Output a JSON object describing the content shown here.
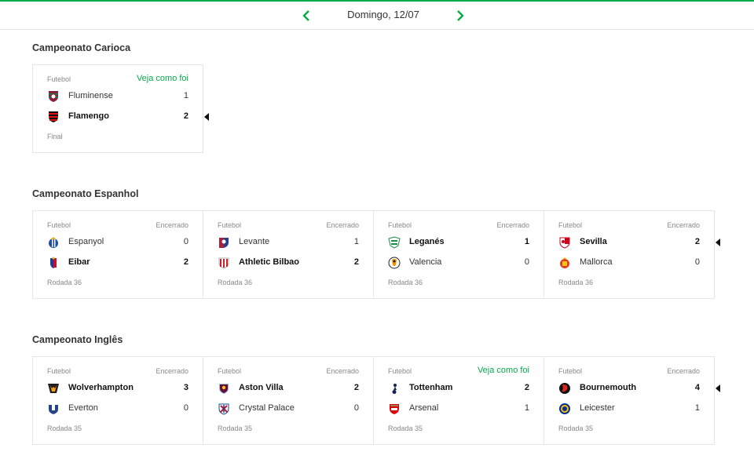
{
  "date_nav": {
    "date_label": "Domingo, 12/07",
    "prev_icon": "chevron-left-icon",
    "next_icon": "chevron-right-icon",
    "accent": "#06aa48"
  },
  "sections": [
    {
      "title": "Campeonato Carioca",
      "matches": [
        {
          "sport": "Futebol",
          "status": "Veja como foi",
          "status_link": true,
          "home": {
            "name": "Fluminense",
            "score": "1",
            "crest": "fluminense-crest-icon"
          },
          "away": {
            "name": "Flamengo",
            "score": "2",
            "crest": "flamengo-crest-icon"
          },
          "winner": "away",
          "footer": "Final"
        }
      ]
    },
    {
      "title": "Campeonato Espanhol",
      "matches": [
        {
          "sport": "Futebol",
          "status": "Encerrado",
          "status_link": false,
          "home": {
            "name": "Espanyol",
            "score": "0",
            "crest": "espanyol-crest-icon"
          },
          "away": {
            "name": "Eibar",
            "score": "2",
            "crest": "eibar-crest-icon"
          },
          "winner": "away",
          "footer": "Rodada 36"
        },
        {
          "sport": "Futebol",
          "status": "Encerrado",
          "status_link": false,
          "home": {
            "name": "Levante",
            "score": "1",
            "crest": "levante-crest-icon"
          },
          "away": {
            "name": "Athletic Bilbao",
            "score": "2",
            "crest": "athletic-bilbao-crest-icon"
          },
          "winner": "away",
          "footer": "Rodada 36"
        },
        {
          "sport": "Futebol",
          "status": "Encerrado",
          "status_link": false,
          "home": {
            "name": "Leganés",
            "score": "1",
            "crest": "leganes-crest-icon"
          },
          "away": {
            "name": "Valencia",
            "score": "0",
            "crest": "valencia-crest-icon"
          },
          "winner": "home",
          "footer": "Rodada 36"
        },
        {
          "sport": "Futebol",
          "status": "Encerrado",
          "status_link": false,
          "home": {
            "name": "Sevilla",
            "score": "2",
            "crest": "sevilla-crest-icon"
          },
          "away": {
            "name": "Mallorca",
            "score": "0",
            "crest": "mallorca-crest-icon"
          },
          "winner": "home",
          "footer": "Rodada 36"
        }
      ]
    },
    {
      "title": "Campeonato Inglês",
      "matches": [
        {
          "sport": "Futebol",
          "status": "Encerrado",
          "status_link": false,
          "home": {
            "name": "Wolverhampton",
            "score": "3",
            "crest": "wolverhampton-crest-icon"
          },
          "away": {
            "name": "Everton",
            "score": "0",
            "crest": "everton-crest-icon"
          },
          "winner": "home",
          "footer": "Rodada 35"
        },
        {
          "sport": "Futebol",
          "status": "Encerrado",
          "status_link": false,
          "home": {
            "name": "Aston Villa",
            "score": "2",
            "crest": "aston-villa-crest-icon"
          },
          "away": {
            "name": "Crystal Palace",
            "score": "0",
            "crest": "crystal-palace-crest-icon"
          },
          "winner": "home",
          "footer": "Rodada 35"
        },
        {
          "sport": "Futebol",
          "status": "Veja como foi",
          "status_link": true,
          "home": {
            "name": "Tottenham",
            "score": "2",
            "crest": "tottenham-crest-icon"
          },
          "away": {
            "name": "Arsenal",
            "score": "1",
            "crest": "arsenal-crest-icon"
          },
          "winner": "home",
          "footer": "Rodada 35"
        },
        {
          "sport": "Futebol",
          "status": "Encerrado",
          "status_link": false,
          "home": {
            "name": "Bournemouth",
            "score": "4",
            "crest": "bournemouth-crest-icon"
          },
          "away": {
            "name": "Leicester",
            "score": "1",
            "crest": "leicester-crest-icon"
          },
          "winner": "home",
          "footer": "Rodada 35"
        }
      ]
    }
  ]
}
